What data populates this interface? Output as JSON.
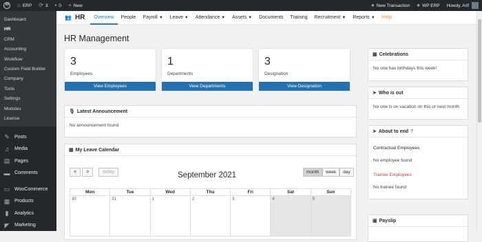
{
  "adminbar": {
    "site_name": "ERP",
    "updates_count": "3",
    "comments_count": "0",
    "new_label": "New",
    "new_transaction_label": "New Transaction",
    "wp_erp_label": "WP ERP",
    "howdy": "Howdy, Arif"
  },
  "sidebar": {
    "sub_items": [
      "Dashboard",
      "HR",
      "CRM",
      "Accounting",
      "Workflow",
      "Custom Field Builder",
      "Company",
      "Tools",
      "Settings",
      "Modules",
      "License"
    ],
    "menu_items": [
      {
        "label": "Posts",
        "icon": "pushpin-icon"
      },
      {
        "label": "Media",
        "icon": "media-icon"
      },
      {
        "label": "Pages",
        "icon": "pages-icon"
      },
      {
        "label": "Comments",
        "icon": "comments-icon"
      },
      {
        "label": "WooCommerce",
        "icon": "woocommerce-icon"
      },
      {
        "label": "Products",
        "icon": "products-icon"
      },
      {
        "label": "Analytics",
        "icon": "analytics-icon"
      },
      {
        "label": "Marketing",
        "icon": "marketing-icon"
      }
    ]
  },
  "topnav": {
    "brand": "HR",
    "items": [
      "Overview",
      "People",
      "Payroll",
      "Leave",
      "Attendance",
      "Assets",
      "Documents",
      "Training",
      "Recruitment",
      "Reports",
      "Help"
    ]
  },
  "page_title": "HR Management",
  "stats": [
    {
      "number": "3",
      "label": "Employees",
      "button": "View Employees"
    },
    {
      "number": "1",
      "label": "Departments",
      "button": "View Departments"
    },
    {
      "number": "3",
      "label": "Designation",
      "button": "View Designation"
    }
  ],
  "announcement": {
    "title": "Latest Announcement",
    "body": "No announcement found"
  },
  "calendar": {
    "title": "My Leave Calendar",
    "month_title": "September 2021",
    "prev": "<",
    "next": ">",
    "today": "today",
    "views": [
      "month",
      "week",
      "day"
    ],
    "days": [
      "Mon",
      "Tue",
      "Wed",
      "Thu",
      "Fri",
      "Sat",
      "Sun"
    ],
    "first_row": [
      "30",
      "31",
      "1",
      "2",
      "3",
      "4",
      "5"
    ]
  },
  "celebrations": {
    "title": "Celebrations",
    "body": "No one has birthdays this week!"
  },
  "who_is_out": {
    "title": "Who is out",
    "body": "No one is on vacation on this or next month"
  },
  "about_to_end": {
    "title": "About to end",
    "contractual_label": "Contractual Employees",
    "contractual_body": "No employee found",
    "trainee_label": "Trainee Employees",
    "trainee_body": "No trainee found",
    "trainee_color": "#d63638"
  },
  "payslip": {
    "title": "Payslip"
  },
  "colors": {
    "primary_button": "#2271b1",
    "active_nav": "#1a7fd0",
    "help": "#f0932b",
    "admin_bg": "#23282d"
  }
}
